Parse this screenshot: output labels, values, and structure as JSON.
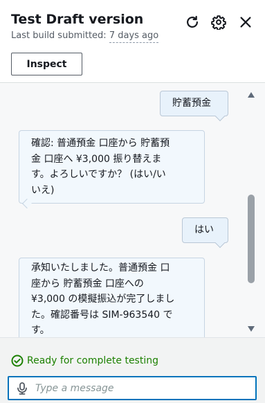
{
  "header": {
    "title": "Test Draft version",
    "subtitle_prefix": "Last build submitted:",
    "subtitle_ago": "7 days ago",
    "inspect_label": "Inspect",
    "icons": [
      "refresh-icon",
      "settings-icon",
      "close-icon"
    ]
  },
  "chat": {
    "messages": [
      {
        "role": "user",
        "text": "貯蓄預金"
      },
      {
        "role": "bot",
        "lines": [
          "確認: 普通預金 口座から 貯蓄預",
          "金 口座へ ¥3,000 振り替えま",
          "す。よろしいですか？ (はい/い",
          "いえ)"
        ]
      },
      {
        "role": "user",
        "text": "はい"
      },
      {
        "role": "bot",
        "lines": [
          "承知いたしました。普通預金 口",
          "座から 貯蓄預金 口座への",
          "¥3,000 の模擬振込が完了しまし",
          "た。確認番号は SIM-963540 で",
          "す。"
        ]
      }
    ]
  },
  "footer": {
    "status_text": "Ready for complete testing",
    "status_color": "#1d8102",
    "input_placeholder": "Type a message"
  }
}
